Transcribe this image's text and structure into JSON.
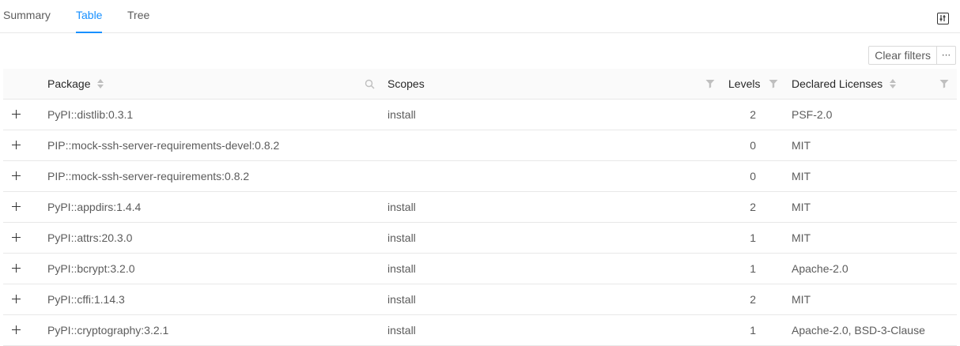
{
  "tabs": [
    {
      "label": "Summary",
      "active": false
    },
    {
      "label": "Table",
      "active": true
    },
    {
      "label": "Tree",
      "active": false
    }
  ],
  "settings_icon": "sliders-icon",
  "toolbar": {
    "clear_filters_label": "Clear filters",
    "more_label": "···"
  },
  "table": {
    "columns": {
      "package": "Package",
      "scopes": "Scopes",
      "levels": "Levels",
      "licenses": "Declared Licenses"
    },
    "rows": [
      {
        "package": "PyPI::distlib:0.3.1",
        "scopes": "install",
        "levels": "2",
        "licenses": "PSF-2.0"
      },
      {
        "package": "PIP::mock-ssh-server-requirements-devel:0.8.2",
        "scopes": "",
        "levels": "0",
        "licenses": "MIT"
      },
      {
        "package": "PIP::mock-ssh-server-requirements:0.8.2",
        "scopes": "",
        "levels": "0",
        "licenses": "MIT"
      },
      {
        "package": "PyPI::appdirs:1.4.4",
        "scopes": "install",
        "levels": "2",
        "licenses": "MIT"
      },
      {
        "package": "PyPI::attrs:20.3.0",
        "scopes": "install",
        "levels": "1",
        "licenses": "MIT"
      },
      {
        "package": "PyPI::bcrypt:3.2.0",
        "scopes": "install",
        "levels": "1",
        "licenses": "Apache-2.0"
      },
      {
        "package": "PyPI::cffi:1.14.3",
        "scopes": "install",
        "levels": "2",
        "licenses": "MIT"
      },
      {
        "package": "PyPI::cryptography:3.2.1",
        "scopes": "install",
        "levels": "1",
        "licenses": "Apache-2.0, BSD-3-Clause"
      }
    ]
  },
  "colors": {
    "accent": "#1890ff",
    "header_bg": "#fafafa",
    "border": "#e8e8e8"
  }
}
